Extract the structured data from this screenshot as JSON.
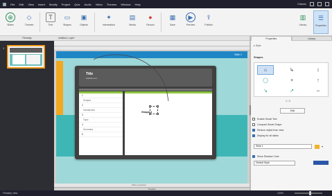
{
  "menubar": {
    "items": [
      "File",
      "Edit",
      "View",
      "Insert",
      "Modify",
      "Project",
      "Quiz",
      "Audio",
      "Video",
      "Themes",
      "Window",
      "Help"
    ],
    "user": "Classic"
  },
  "ribbon": {
    "buttons": [
      {
        "label": "Slides",
        "icon": "slides-icon",
        "glyph": "⊕",
        "color": "#2a8f5a"
      },
      {
        "label": "Themes",
        "icon": "themes-icon",
        "glyph": "◇",
        "color": "#3a6fb0"
      },
      {
        "label": "Text",
        "icon": "text-icon",
        "glyph": "T",
        "color": "#555"
      },
      {
        "label": "Shapes",
        "icon": "shapes-icon",
        "glyph": "▭",
        "color": "#3a6fb0"
      },
      {
        "label": "Objects",
        "icon": "objects-icon",
        "glyph": "▣",
        "color": "#3a6fb0"
      },
      {
        "label": "Interactions",
        "icon": "interactions-icon",
        "glyph": "✦",
        "color": "#3a6fb0"
      },
      {
        "label": "Media",
        "icon": "media-icon",
        "glyph": "▤",
        "color": "#3a6fb0"
      },
      {
        "label": "Record",
        "icon": "microphone-icon",
        "glyph": "●",
        "color": "#d23b3b"
      },
      {
        "label": "Save",
        "icon": "save-icon",
        "glyph": "▦",
        "color": "#3a6fb0"
      },
      {
        "label": "Preview",
        "icon": "preview-icon",
        "glyph": "▶",
        "color": "#3a6fb0"
      },
      {
        "label": "Publish",
        "icon": "publish-icon",
        "glyph": "⇪",
        "color": "#3a6fb0"
      },
      {
        "label": "Library",
        "icon": "library-icon",
        "glyph": "▥",
        "color": "#2a8f5a"
      },
      {
        "label": "Properties",
        "icon": "properties-icon",
        "glyph": "☰",
        "color": "#3a6fb0"
      }
    ]
  },
  "left_pane": {
    "header": "Filmstrip",
    "slide_number": "1"
  },
  "canvas": {
    "tab_label": "Untitled-1.cptx*",
    "bluebar_label": "Slide 1",
    "slide_title": "Title",
    "slide_subtitle": "Subtitle text",
    "list_rows": [
      "1",
      "Subject",
      "2",
      "Introduction",
      "3",
      "Topic",
      "4",
      "Summary",
      "5"
    ],
    "detail_title": "Shape 1",
    "bottom_label": "Slide properties",
    "timeline_label": "Timeline"
  },
  "right_pane": {
    "tabs": [
      "Properties",
      "Library"
    ],
    "style_label": "Style",
    "section_title": "Shapes",
    "shape_glyphs": [
      "⌂",
      "↳",
      "↕",
      "◯",
      "+",
      "↑",
      "↘",
      "↗",
      "⇔"
    ],
    "page_indicator": "1 / 3",
    "button_label": "Edit",
    "checkboxes": [
      {
        "label": "Enable Smart Text",
        "checked": false
      },
      {
        "label": "Compact Smart Shape",
        "checked": false
      },
      {
        "label": "Reduce object from view",
        "checked": true
      },
      {
        "label": "Display for all slides",
        "checked": true
      }
    ],
    "combo_value": "Slide 1",
    "checkbox2": {
      "label": "Show Shadow Color",
      "checked": true
    },
    "combo2_value": "Default Style",
    "accent_color": "#2a57a8",
    "folder_color": "#f0b429"
  },
  "status": {
    "left": "Filmstrip view",
    "right": "100%"
  }
}
